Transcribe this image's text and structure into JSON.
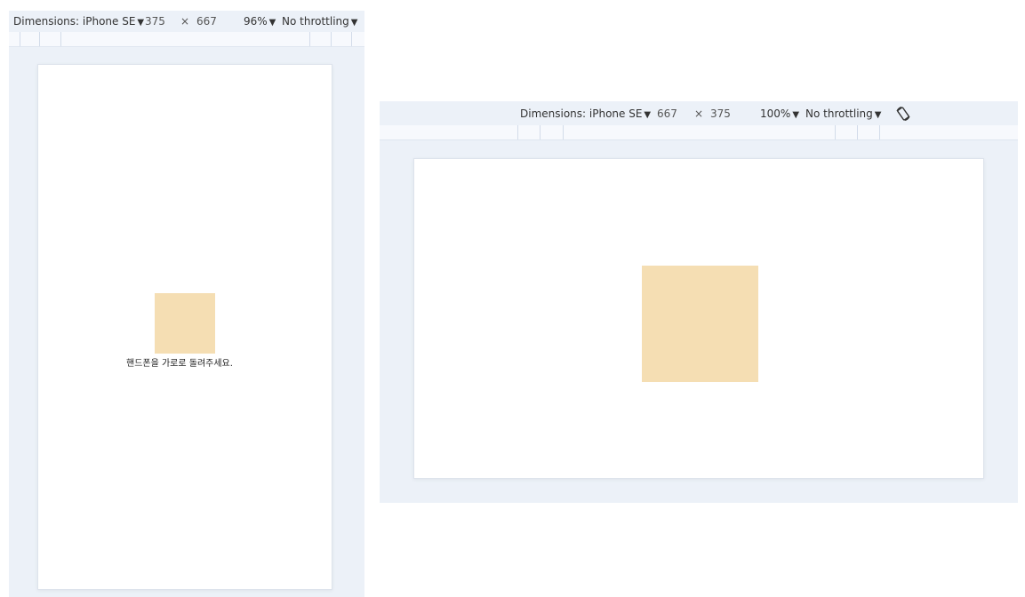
{
  "portrait": {
    "device_label": "Dimensions: iPhone SE",
    "width": "375",
    "times": "×",
    "height": "667",
    "zoom": "96%",
    "throttle": "No throttling",
    "message": "핸드폰을 가로로 돌려주세요."
  },
  "landscape": {
    "device_label": "Dimensions: iPhone SE",
    "width": "667",
    "times": "×",
    "height": "375",
    "zoom": "100%",
    "throttle": "No throttling",
    "rotate_icon": "rotate-icon"
  },
  "caret_glyph": "▼",
  "colors": {
    "panel_bg": "#ecf1f8",
    "square": "#f5deb3"
  }
}
